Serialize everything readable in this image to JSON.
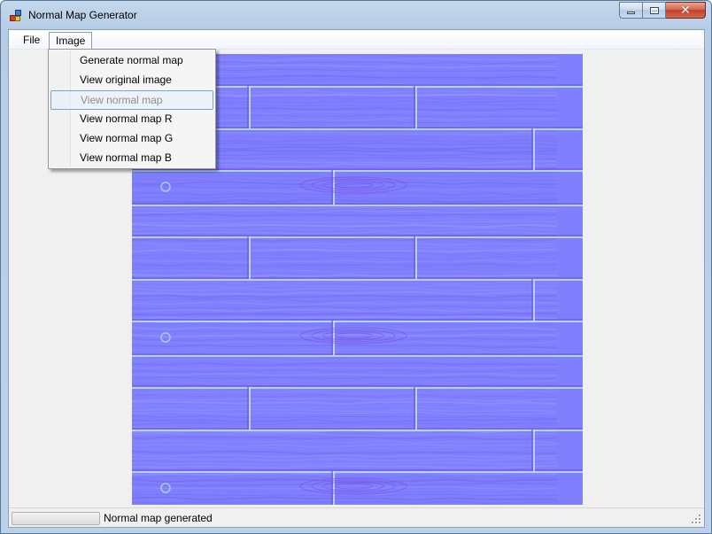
{
  "window": {
    "title": "Normal Map Generator",
    "close_glyph": "✕"
  },
  "menubar": {
    "items": [
      {
        "label": "File"
      },
      {
        "label": "Image"
      }
    ]
  },
  "image_menu": {
    "items": [
      {
        "label": "Generate normal map",
        "enabled": true
      },
      {
        "label": "View original image",
        "enabled": true
      },
      {
        "label": "View normal map",
        "enabled": false
      },
      {
        "label": "View normal map R",
        "enabled": true
      },
      {
        "label": "View normal map G",
        "enabled": true
      },
      {
        "label": "View normal map B",
        "enabled": true
      }
    ]
  },
  "statusbar": {
    "progress_percent": 0,
    "text": "Normal map generated"
  },
  "colors": {
    "normal_map_base": "#8080ff",
    "normal_map_light": "#a6a8ff",
    "normal_map_dark": "#6a5ee8",
    "plank_edge_top": "#b8ecf4",
    "plank_edge_bottom": "#7a4ce0"
  },
  "icons": {
    "app": "app-icon",
    "minimize": "minimize-icon",
    "maximize": "maximize-icon",
    "close": "close-icon",
    "grip": "resize-grip-icon"
  }
}
